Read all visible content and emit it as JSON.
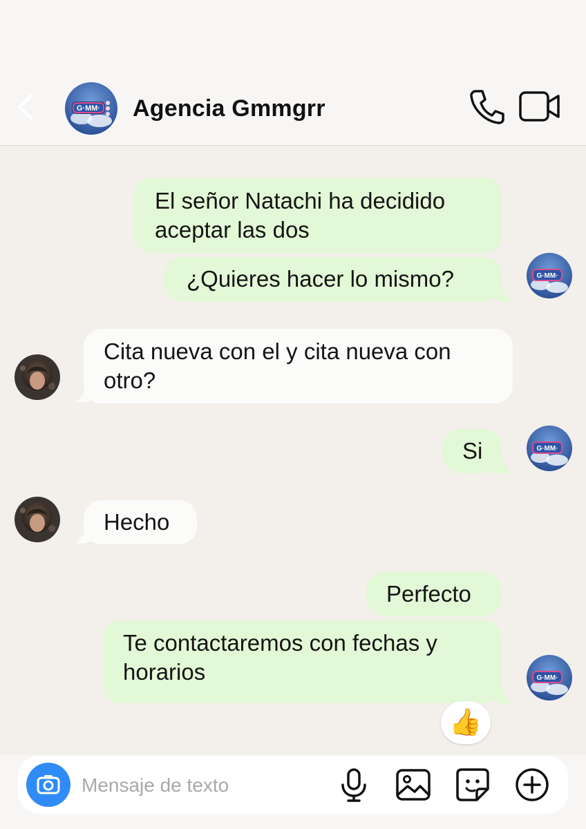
{
  "header": {
    "contact_name": "Agencia Gmmgrr",
    "avatar_text": "G·MM·",
    "icons": {
      "back": "chevron-left-icon",
      "call": "phone-icon",
      "video": "video-camera-icon"
    }
  },
  "messages": [
    {
      "from": "agency",
      "lines": [
        "El señor Natachi ha decidido",
        "aceptar las dos"
      ]
    },
    {
      "from": "agency",
      "lines": [
        "¿Quieres hacer lo mismo?"
      ]
    },
    {
      "from": "user",
      "lines": [
        "Cita nueva con el y cita nueva con",
        "otro?"
      ]
    },
    {
      "from": "agency",
      "lines": [
        "Si"
      ]
    },
    {
      "from": "user",
      "lines": [
        "Hecho"
      ]
    },
    {
      "from": "agency",
      "lines": [
        "Perfecto"
      ]
    },
    {
      "from": "agency",
      "lines": [
        "Te contactaremos con fechas y",
        "horarios"
      ],
      "reaction": "👍"
    }
  ],
  "composer": {
    "placeholder": "Mensaje de texto",
    "accent_color": "#2f8cf6",
    "icons": [
      "camera-icon",
      "microphone-icon",
      "image-icon",
      "sticker-icon",
      "plus-circle-icon"
    ]
  },
  "colors": {
    "sent_bubble": "#e3f8d6",
    "received_bubble": "#fbfbfa",
    "background": "#f3efea"
  }
}
